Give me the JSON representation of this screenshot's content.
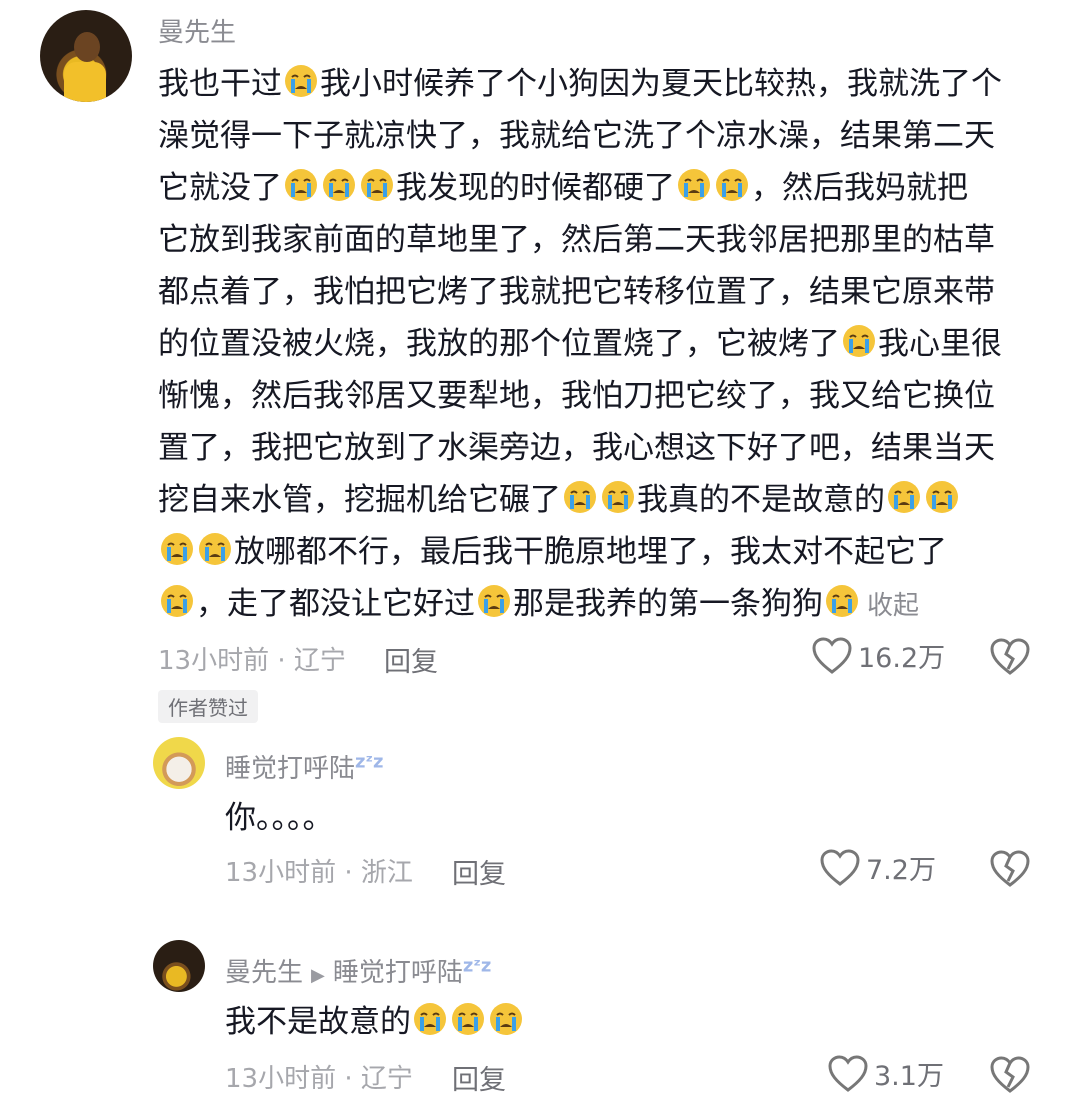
{
  "main_comment": {
    "username": "曼先生",
    "lines": [
      [
        "t:我也干过",
        "e",
        "t:我小时候养了个小狗因为夏天比较热，我就洗了个"
      ],
      [
        "t:澡觉得一下子就凉快了，我就给它洗了个凉水澡，结果第二天"
      ],
      [
        "t:它就没了",
        "e",
        "e",
        "e",
        "t:我发现的时候都硬了",
        "e",
        "e",
        "t:，然后我妈就把"
      ],
      [
        "t:它放到我家前面的草地里了，然后第二天我邻居把那里的枯草"
      ],
      [
        "t:都点着了，我怕把它烤了我就把它转移位置了，结果它原来带"
      ],
      [
        "t:的位置没被火烧，我放的那个位置烧了，它被烤了",
        "e",
        "t:我心里很"
      ],
      [
        "t:惭愧，然后我邻居又要犁地，我怕刀把它绞了，我又给它换位"
      ],
      [
        "t:置了，我把它放到了水渠旁边，我心想这下好了吧，结果当天"
      ],
      [
        "t:挖自来水管，挖掘机给它碾了",
        "e",
        "e",
        "t:我真的不是故意的",
        "e",
        "e"
      ],
      [
        "e",
        "e",
        "t:放哪都不行，最后我干脆原地埋了，我太对不起它了"
      ],
      [
        "e",
        "t:，走了都没让它好过",
        "e",
        "t:那是我养的第一条狗狗",
        "e"
      ]
    ],
    "collapse_label": "收起",
    "meta": "13小时前 · 辽宁",
    "reply_label": "回复",
    "likes": "16.2万",
    "author_badge": "作者赞过"
  },
  "replies": [
    {
      "username": "睡觉打呼陆",
      "username_suffix": "zᶻz",
      "text": "你。。。。",
      "meta": "13小时前 · 浙江",
      "reply_label": "回复",
      "likes": "7.2万"
    },
    {
      "username": "曼先生",
      "reply_to": "睡觉打呼陆",
      "username_suffix": "zᶻz",
      "text": "我不是故意的",
      "emoji_count": 3,
      "meta": "13小时前 · 辽宁",
      "reply_label": "回复",
      "likes": "3.1万"
    }
  ],
  "icons": {
    "emoji": "crying-face-icon",
    "like": "heart-outline-icon",
    "dislike": "broken-heart-icon",
    "reply_arrow": "play-triangle-icon"
  },
  "colors": {
    "text_primary": "#161823",
    "text_secondary": "#8a8b91",
    "emoji_yellow": "#f5c53a",
    "emoji_tear": "#3aa0e8"
  }
}
